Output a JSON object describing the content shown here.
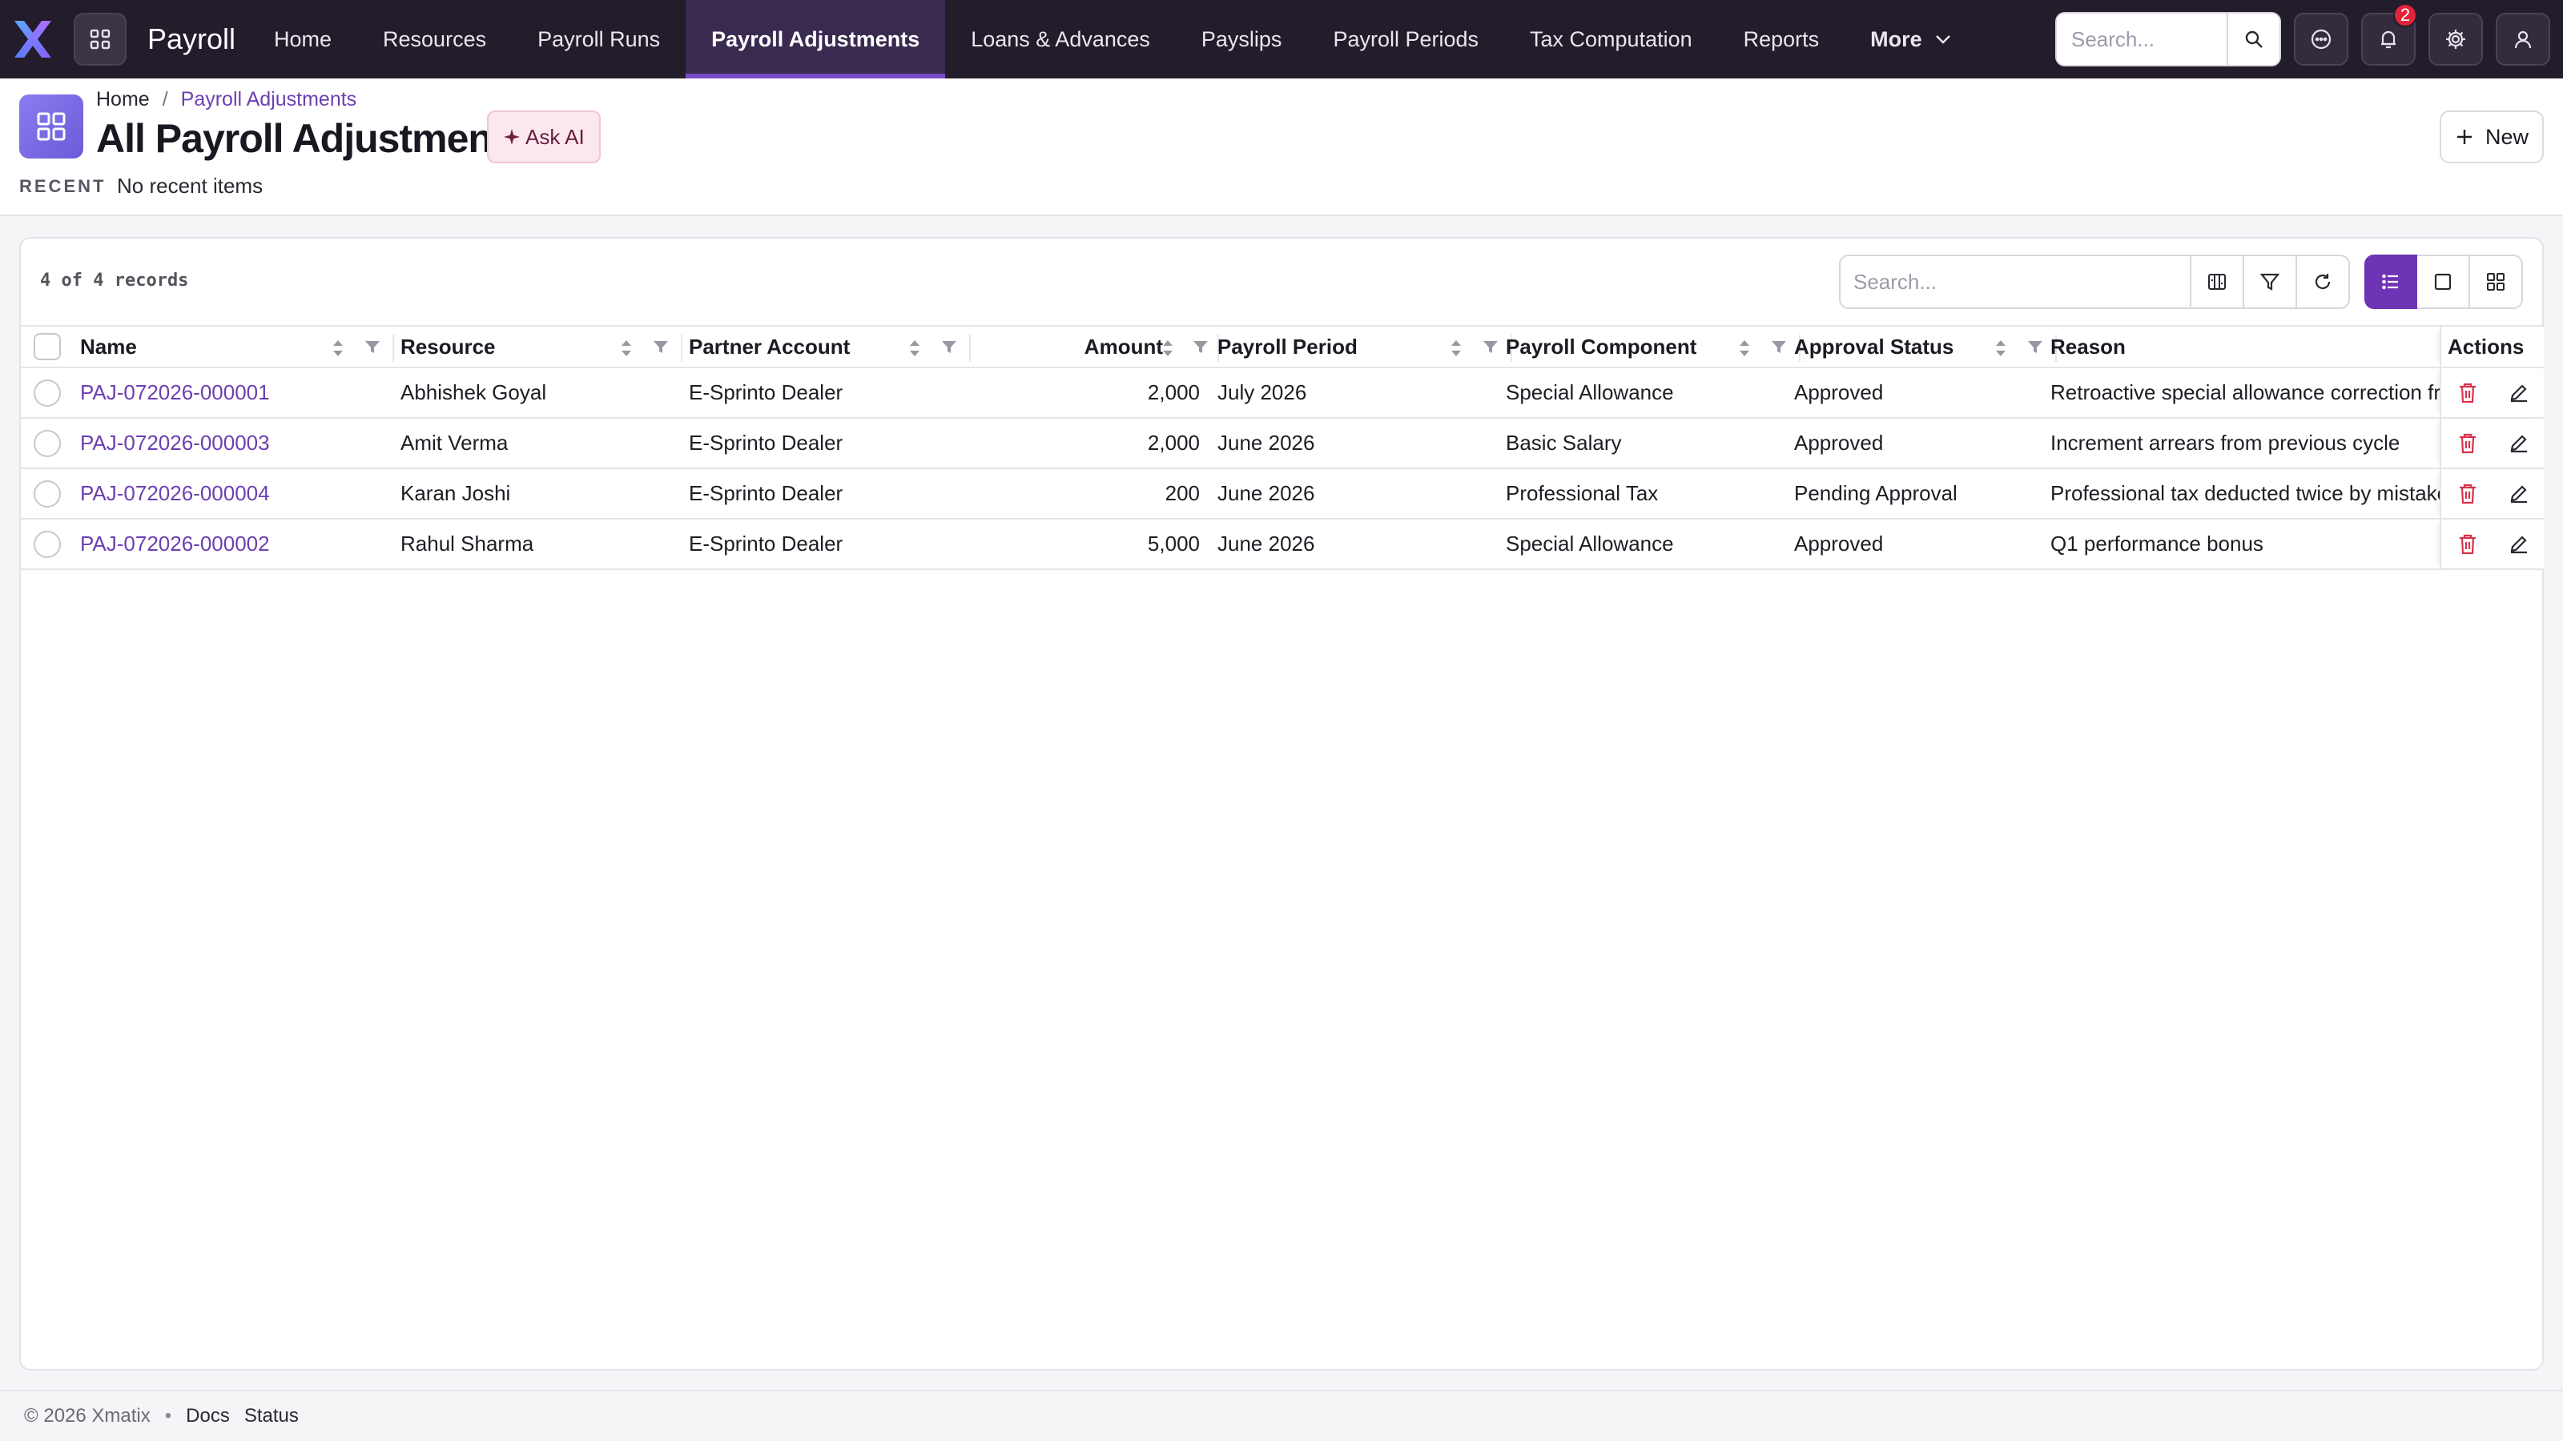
{
  "app": {
    "title": "Payroll"
  },
  "nav": {
    "items": [
      {
        "label": "Home",
        "active": false
      },
      {
        "label": "Resources",
        "active": false
      },
      {
        "label": "Payroll Runs",
        "active": false
      },
      {
        "label": "Payroll Adjustments",
        "active": true
      },
      {
        "label": "Loans & Advances",
        "active": false
      },
      {
        "label": "Payslips",
        "active": false
      },
      {
        "label": "Payroll Periods",
        "active": false
      },
      {
        "label": "Tax Computation",
        "active": false
      },
      {
        "label": "Reports",
        "active": false
      }
    ],
    "more_label": "More",
    "search_placeholder": "Search...",
    "notification_count": "2"
  },
  "breadcrumb": {
    "home": "Home",
    "separator": "/",
    "current": "Payroll Adjustments"
  },
  "page": {
    "title": "All Payroll Adjustment",
    "ask_ai_label": "Ask AI",
    "new_label": "New",
    "recent_label": "RECENT",
    "recent_value": "No recent items"
  },
  "list": {
    "record_count": "4 of 4 records",
    "search_placeholder": "Search...",
    "columns": {
      "name": "Name",
      "resource": "Resource",
      "partner_account": "Partner Account",
      "amount": "Amount",
      "payroll_period": "Payroll Period",
      "payroll_component": "Payroll Component",
      "approval_status": "Approval Status",
      "reason": "Reason",
      "actions": "Actions"
    },
    "rows": [
      {
        "name": "PAJ-072026-000001",
        "resource": "Abhishek Goyal",
        "partner_account": "E-Sprinto Dealer",
        "amount": "2,000",
        "payroll_period": "July 2026",
        "payroll_component": "Special Allowance",
        "approval_status": "Approved",
        "reason": "Retroactive special allowance correction fro"
      },
      {
        "name": "PAJ-072026-000003",
        "resource": "Amit Verma",
        "partner_account": "E-Sprinto Dealer",
        "amount": "2,000",
        "payroll_period": "June 2026",
        "payroll_component": "Basic Salary",
        "approval_status": "Approved",
        "reason": "Increment arrears from previous cycle"
      },
      {
        "name": "PAJ-072026-000004",
        "resource": "Karan Joshi",
        "partner_account": "E-Sprinto Dealer",
        "amount": "200",
        "payroll_period": "June 2026",
        "payroll_component": "Professional Tax",
        "approval_status": "Pending Approval",
        "reason": "Professional tax deducted twice by mistake"
      },
      {
        "name": "PAJ-072026-000002",
        "resource": "Rahul Sharma",
        "partner_account": "E-Sprinto Dealer",
        "amount": "5,000",
        "payroll_period": "June 2026",
        "payroll_component": "Special Allowance",
        "approval_status": "Approved",
        "reason": "Q1 performance bonus"
      }
    ]
  },
  "footer": {
    "copyright": "© 2026 Xmatix",
    "bullet": "•",
    "docs": "Docs",
    "status": "Status"
  },
  "colors": {
    "nav_bg": "#221c2b",
    "accent": "#6e34b5",
    "link": "#6b3fb0",
    "delete": "#d6334a"
  },
  "icons": [
    "x-logo-icon",
    "apps-grid-icon",
    "chevron-down-icon",
    "search-icon",
    "chat-icon",
    "bell-icon",
    "gear-icon",
    "user-icon",
    "grid-icon",
    "sparkle-icon",
    "plus-icon",
    "columns-icon",
    "filter-icon",
    "refresh-icon",
    "list-view-icon",
    "card-view-icon",
    "grid-view-icon",
    "sort-icon",
    "trash-icon",
    "edit-icon"
  ]
}
